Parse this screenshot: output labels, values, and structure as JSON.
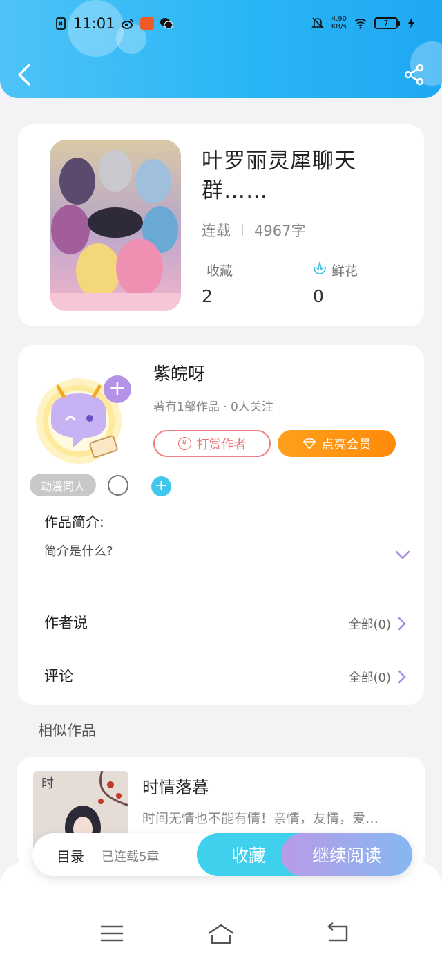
{
  "status_bar": {
    "time": "11:01",
    "net_speed_value": "4.90",
    "net_speed_unit": "KB/s",
    "battery": "7",
    "icons": [
      "sim-icon",
      "weibo-icon",
      "app-badge-icon",
      "wechat-icon",
      "mute-icon",
      "wifi-icon",
      "battery-icon",
      "charging-icon"
    ]
  },
  "header": {
    "back_icon": "chevron-left-icon",
    "share_icon": "share-icon",
    "accent": "#29b6f6"
  },
  "book": {
    "title": "叶罗丽灵犀聊天群……",
    "status": "连载",
    "word_count": "4967字",
    "collect_label": "收藏",
    "collect_value": "2",
    "flower_label": "鲜花",
    "flower_value": "0"
  },
  "author": {
    "name": "紫皖呀",
    "info": "著有1部作品 · 0人关注",
    "reward_label": "打赏作者",
    "vip_label": "点亮会员",
    "tag": "动漫同人",
    "intro_title": "作品简介:",
    "intro_text": "简介是什么?",
    "author_says_label": "作者说",
    "author_says_link": "全部(0)",
    "comments_label": "评论",
    "comments_link": "全部(0)"
  },
  "similar": {
    "section_title": "相似作品",
    "items": [
      {
        "title": "时情落暮",
        "desc": "时间无情也不能有情！亲情，友情，爱…",
        "cover_text": "时"
      }
    ]
  },
  "bottom_bar": {
    "menu_label": "目录",
    "chapter_count": "已连载5章",
    "collect_label": "收藏",
    "read_label": "继续阅读"
  },
  "nav": {
    "icons": [
      "menu-icon",
      "home-icon",
      "back-icon"
    ]
  }
}
